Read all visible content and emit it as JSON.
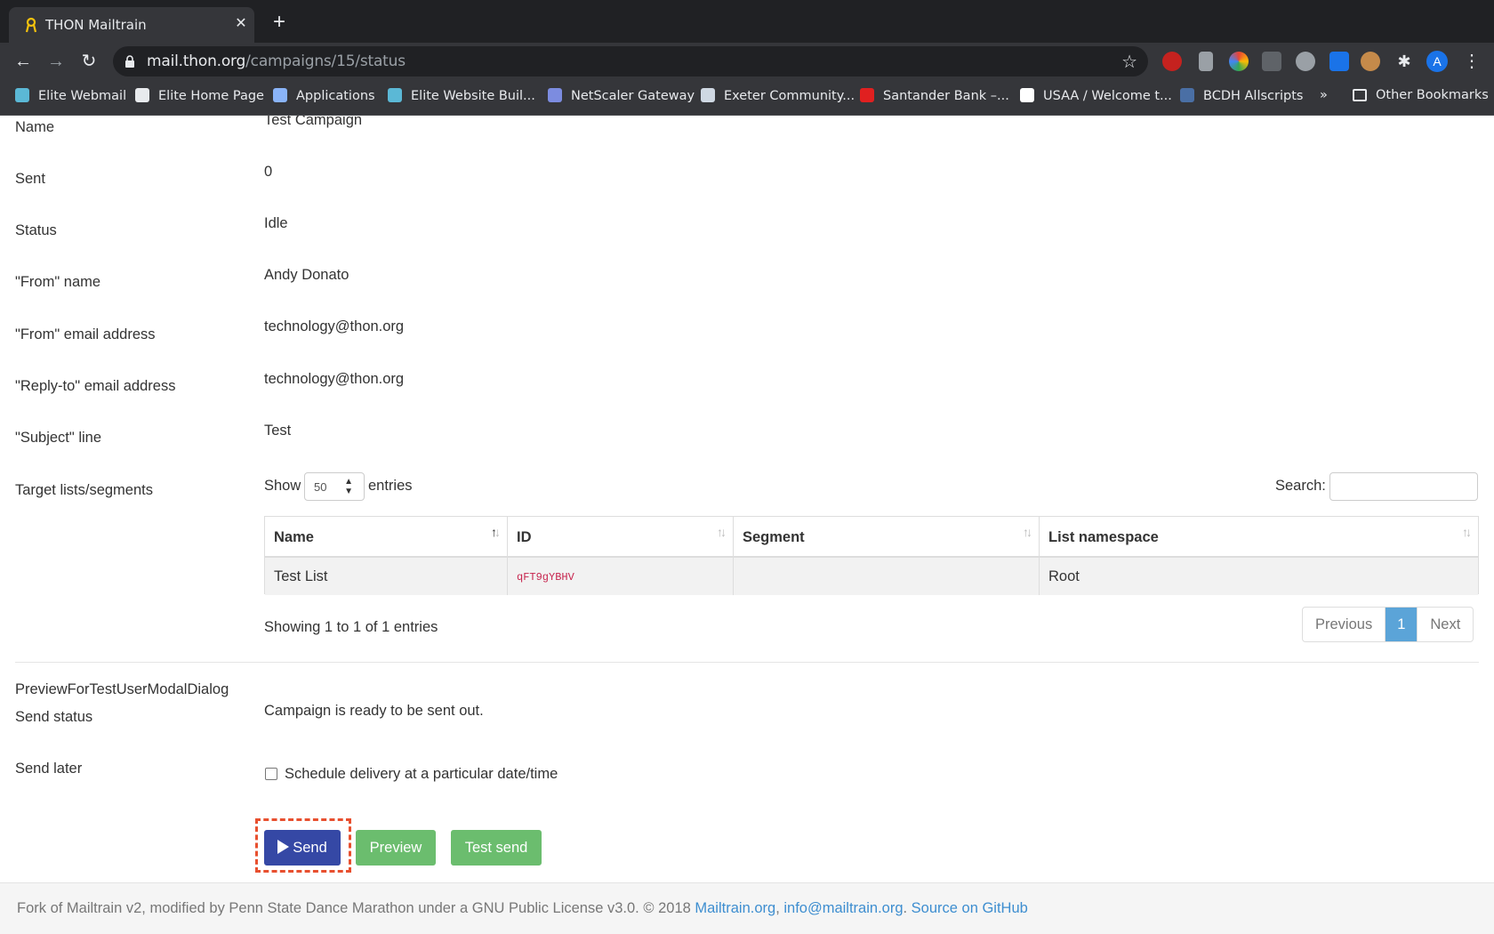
{
  "browser": {
    "tab_title": "THON Mailtrain",
    "url_host": "mail.thon.org",
    "url_path": "/campaigns/15/status",
    "profile_initial": "A",
    "bookmarks": [
      {
        "label": "Elite Webmail",
        "color": "#5bb8d6"
      },
      {
        "label": "Elite Home Page",
        "color": "#e8eaed"
      },
      {
        "label": "Applications",
        "color": "#8ab4f8"
      },
      {
        "label": "Elite Website Buil...",
        "color": "#5bb8d6"
      },
      {
        "label": "NetScaler Gateway",
        "color": "#7c8ce0"
      },
      {
        "label": "Exeter Community...",
        "color": "#cfd8e3"
      },
      {
        "label": "Santander Bank –...",
        "color": "#e02020"
      },
      {
        "label": "USAA / Welcome t...",
        "color": "#ffffff"
      },
      {
        "label": "BCDH Allscripts",
        "color": "#4a6fa5"
      }
    ],
    "bookmarks_overflow": "»",
    "other_bookmarks": "Other Bookmarks"
  },
  "campaign": {
    "fields": [
      {
        "label": "Name",
        "value": "Test Campaign"
      },
      {
        "label": "Sent",
        "value": "0"
      },
      {
        "label": "Status",
        "value": "Idle"
      },
      {
        "label": "\"From\" name",
        "value": "Andy Donato"
      },
      {
        "label": "\"From\" email address",
        "value": "technology@thon.org"
      },
      {
        "label": "\"Reply-to\" email address",
        "value": "technology@thon.org"
      },
      {
        "label": "\"Subject\" line",
        "value": "Test"
      },
      {
        "label": "Target lists/segments",
        "value": ""
      }
    ]
  },
  "table": {
    "show_label": "Show",
    "page_length": "50",
    "entries_label": "entries",
    "search_label": "Search:",
    "search_value": "",
    "columns": [
      "Name",
      "ID",
      "Segment",
      "List namespace"
    ],
    "rows": [
      {
        "name": "Test List",
        "id": "qFT9gYBHV",
        "segment": "",
        "namespace": "Root"
      }
    ],
    "info": "Showing 1 to 1 of 1 entries",
    "pagination": {
      "previous": "Previous",
      "current": "1",
      "next": "Next"
    }
  },
  "send_section": {
    "preview_dialog_label": "PreviewForTestUserModalDialog",
    "send_status_label": "Send status",
    "send_status_value": "Campaign is ready to be sent out.",
    "send_later_label": "Send later",
    "schedule_checkbox_label": "Schedule delivery at a particular date/time",
    "schedule_checked": false,
    "buttons": {
      "send": "Send",
      "preview": "Preview",
      "test_send": "Test send"
    }
  },
  "footer": {
    "text": "Fork of Mailtrain v2, modified by Penn State Dance Marathon under a GNU Public License v3.0. © 2018 ",
    "link1": "Mailtrain.org",
    "sep1": ", ",
    "link2": "info@mailtrain.org",
    "sep2": ". ",
    "link3": "Source on GitHub"
  },
  "colors": {
    "primary_button": "#3548a5",
    "success_button": "#6bbd6e",
    "focus_ring": "#e8502f",
    "link": "#3e8ed0",
    "active_page": "#5ba4d8"
  }
}
